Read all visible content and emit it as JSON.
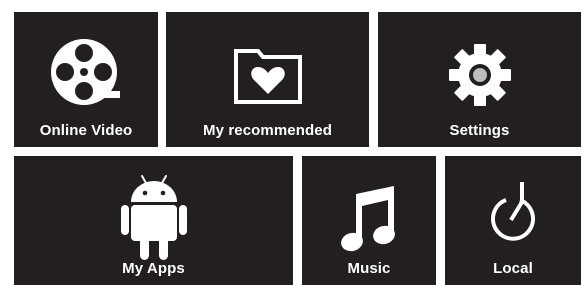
{
  "colors": {
    "tile_background": "#231f20",
    "page_background": "#ffffff",
    "foreground": "#ffffff"
  },
  "tiles": [
    {
      "label": "Online Video",
      "icon": "film-reel-icon"
    },
    {
      "label": "My recommended",
      "icon": "heart-folder-icon"
    },
    {
      "label": "Settings",
      "icon": "gear-icon"
    },
    {
      "label": "My Apps",
      "icon": "android-icon"
    },
    {
      "label": "Music",
      "icon": "music-note-icon"
    },
    {
      "label": "Local",
      "icon": "local-storage-icon"
    }
  ]
}
